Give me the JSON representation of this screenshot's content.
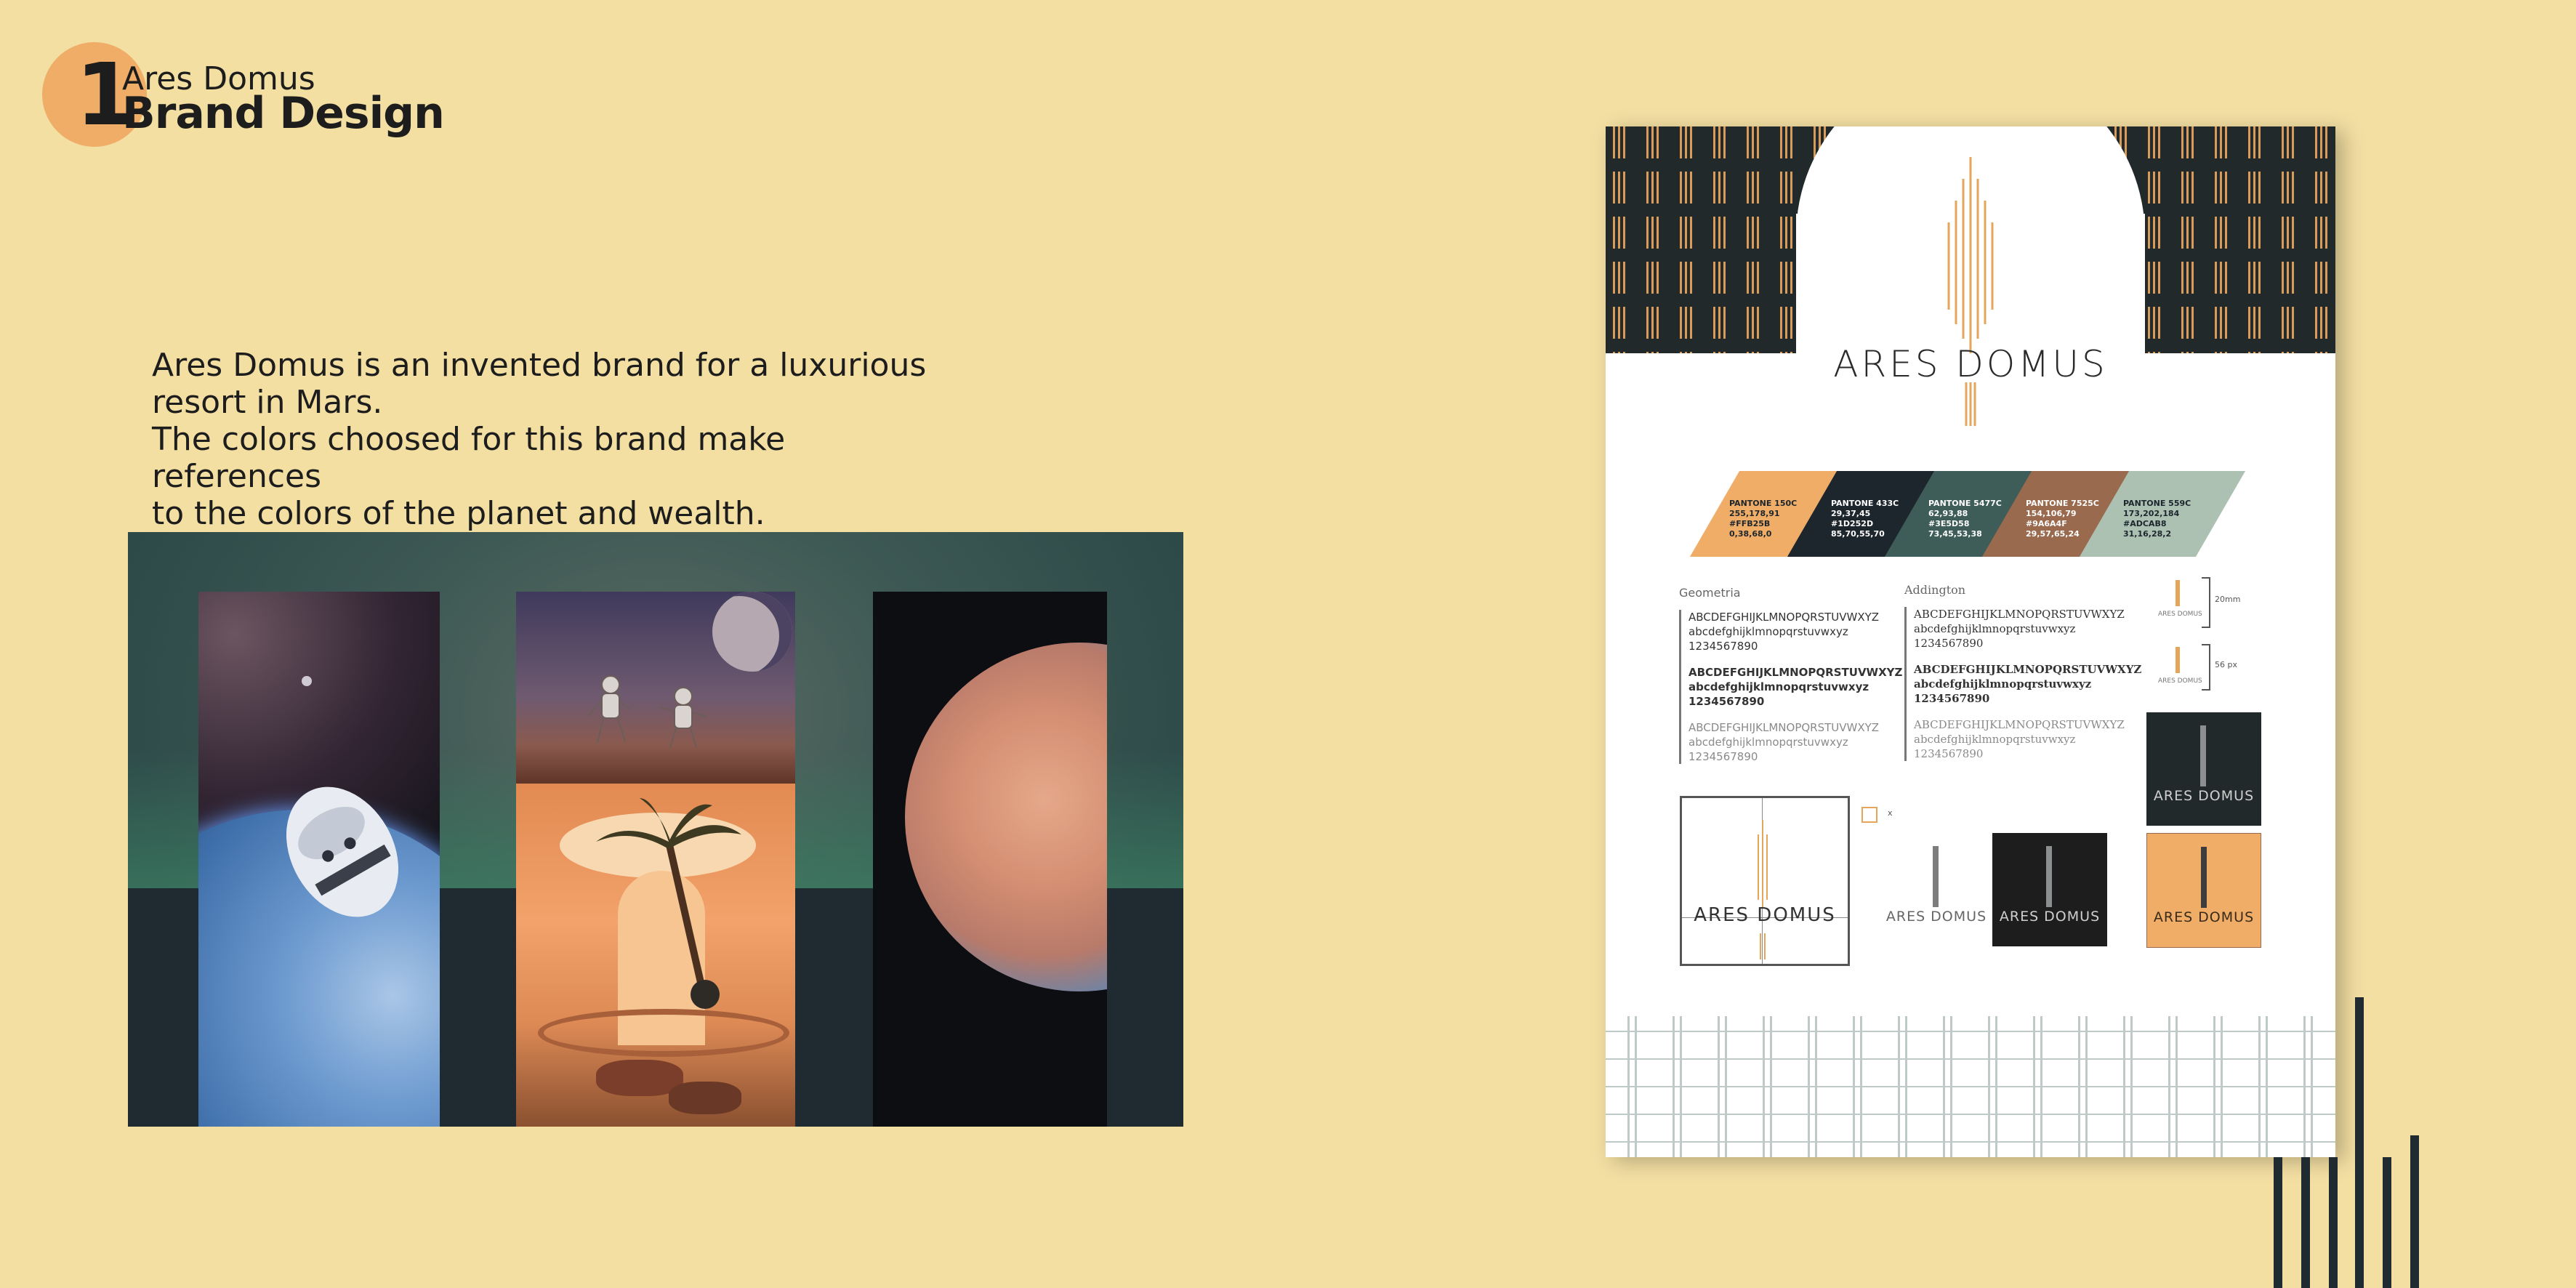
{
  "header": {
    "number": "1",
    "subtitle": "Ares Domus",
    "title": "Brand Design"
  },
  "description": {
    "line1": "Ares Domus is an invented brand for a luxurious",
    "line2": "resort in Mars.",
    "line3": "The colors choosed for this brand make references",
    "line4": "to the colors of the planet and wealth."
  },
  "sheet": {
    "brand_name": "ARES DOMUS",
    "swatches": [
      {
        "pantone": "PANTONE 150C",
        "rgb": "255,178,91",
        "hex": "#FFB25B",
        "cmyk": "0,38,68,0",
        "color": "#efad67"
      },
      {
        "pantone": "PANTONE 433C",
        "rgb": "29,37,45",
        "hex": "#1D252D",
        "cmyk": "85,70,55,70",
        "color": "#1d252d"
      },
      {
        "pantone": "PANTONE 5477C",
        "rgb": "62,93,88",
        "hex": "#3E5D58",
        "cmyk": "73,45,53,38",
        "color": "#3e5d58"
      },
      {
        "pantone": "PANTONE 7525C",
        "rgb": "154,106,79",
        "hex": "#9A6A4F",
        "cmyk": "29,57,65,24",
        "color": "#9a6a4f"
      },
      {
        "pantone": "PANTONE 559C",
        "rgb": "173,202,184",
        "hex": "#ADCAB8",
        "cmyk": "31,16,28,2",
        "color": "#adc1b3"
      }
    ],
    "font1": {
      "name": "Geometria",
      "upper": "ABCDEFGHIJKLMNOPQRSTUVWXYZ",
      "lower": "abcdefghijklmnopqrstuvwxyz",
      "digits": "1234567890"
    },
    "font2": {
      "name": "Addington",
      "upper": "ABCDEFGHIJKLMNOPQRSTUVWXYZ",
      "lower": "abcdefghijklmnopqrstuvwxyz",
      "digits": "1234567890"
    },
    "sizes": {
      "min_print": "20mm",
      "min_screen": "56 px",
      "small_label": "ARES DOMUS"
    },
    "logo_label": "ARES DOMUS",
    "grid_marker": "x"
  }
}
